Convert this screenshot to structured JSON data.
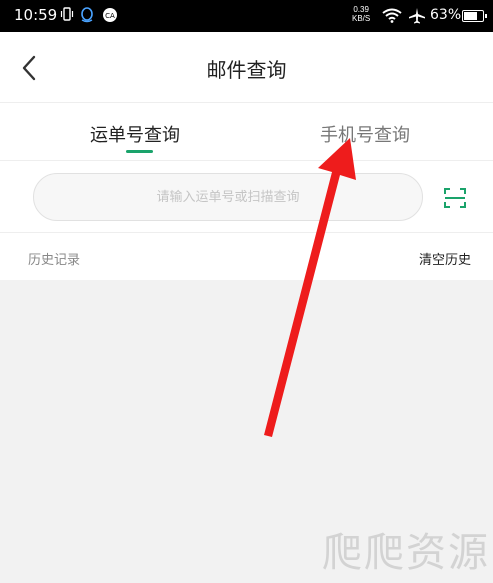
{
  "status_bar": {
    "time": "10:59",
    "net_speed_value": "0.39",
    "net_speed_unit": "KB/S",
    "battery_percent": "63%",
    "battery_level": 0.63,
    "icons": [
      "vibrate-icon",
      "qq-icon",
      "ca-icon",
      "wifi-icon",
      "airplane-icon",
      "battery-icon"
    ]
  },
  "header": {
    "title": "邮件查询",
    "back_icon": "chevron-left-icon"
  },
  "tabs": [
    {
      "label": "运单号查询",
      "active": true
    },
    {
      "label": "手机号查询",
      "active": false
    }
  ],
  "search": {
    "placeholder": "请输入运单号或扫描查询",
    "value": "",
    "scan_icon": "scan-icon"
  },
  "history": {
    "label": "历史记录",
    "clear_label": "清空历史"
  },
  "watermark": "爬爬资源",
  "colors": {
    "accent": "#1aa36b",
    "annotation_arrow": "#ee1c1c",
    "background": "#f2f2f2"
  }
}
